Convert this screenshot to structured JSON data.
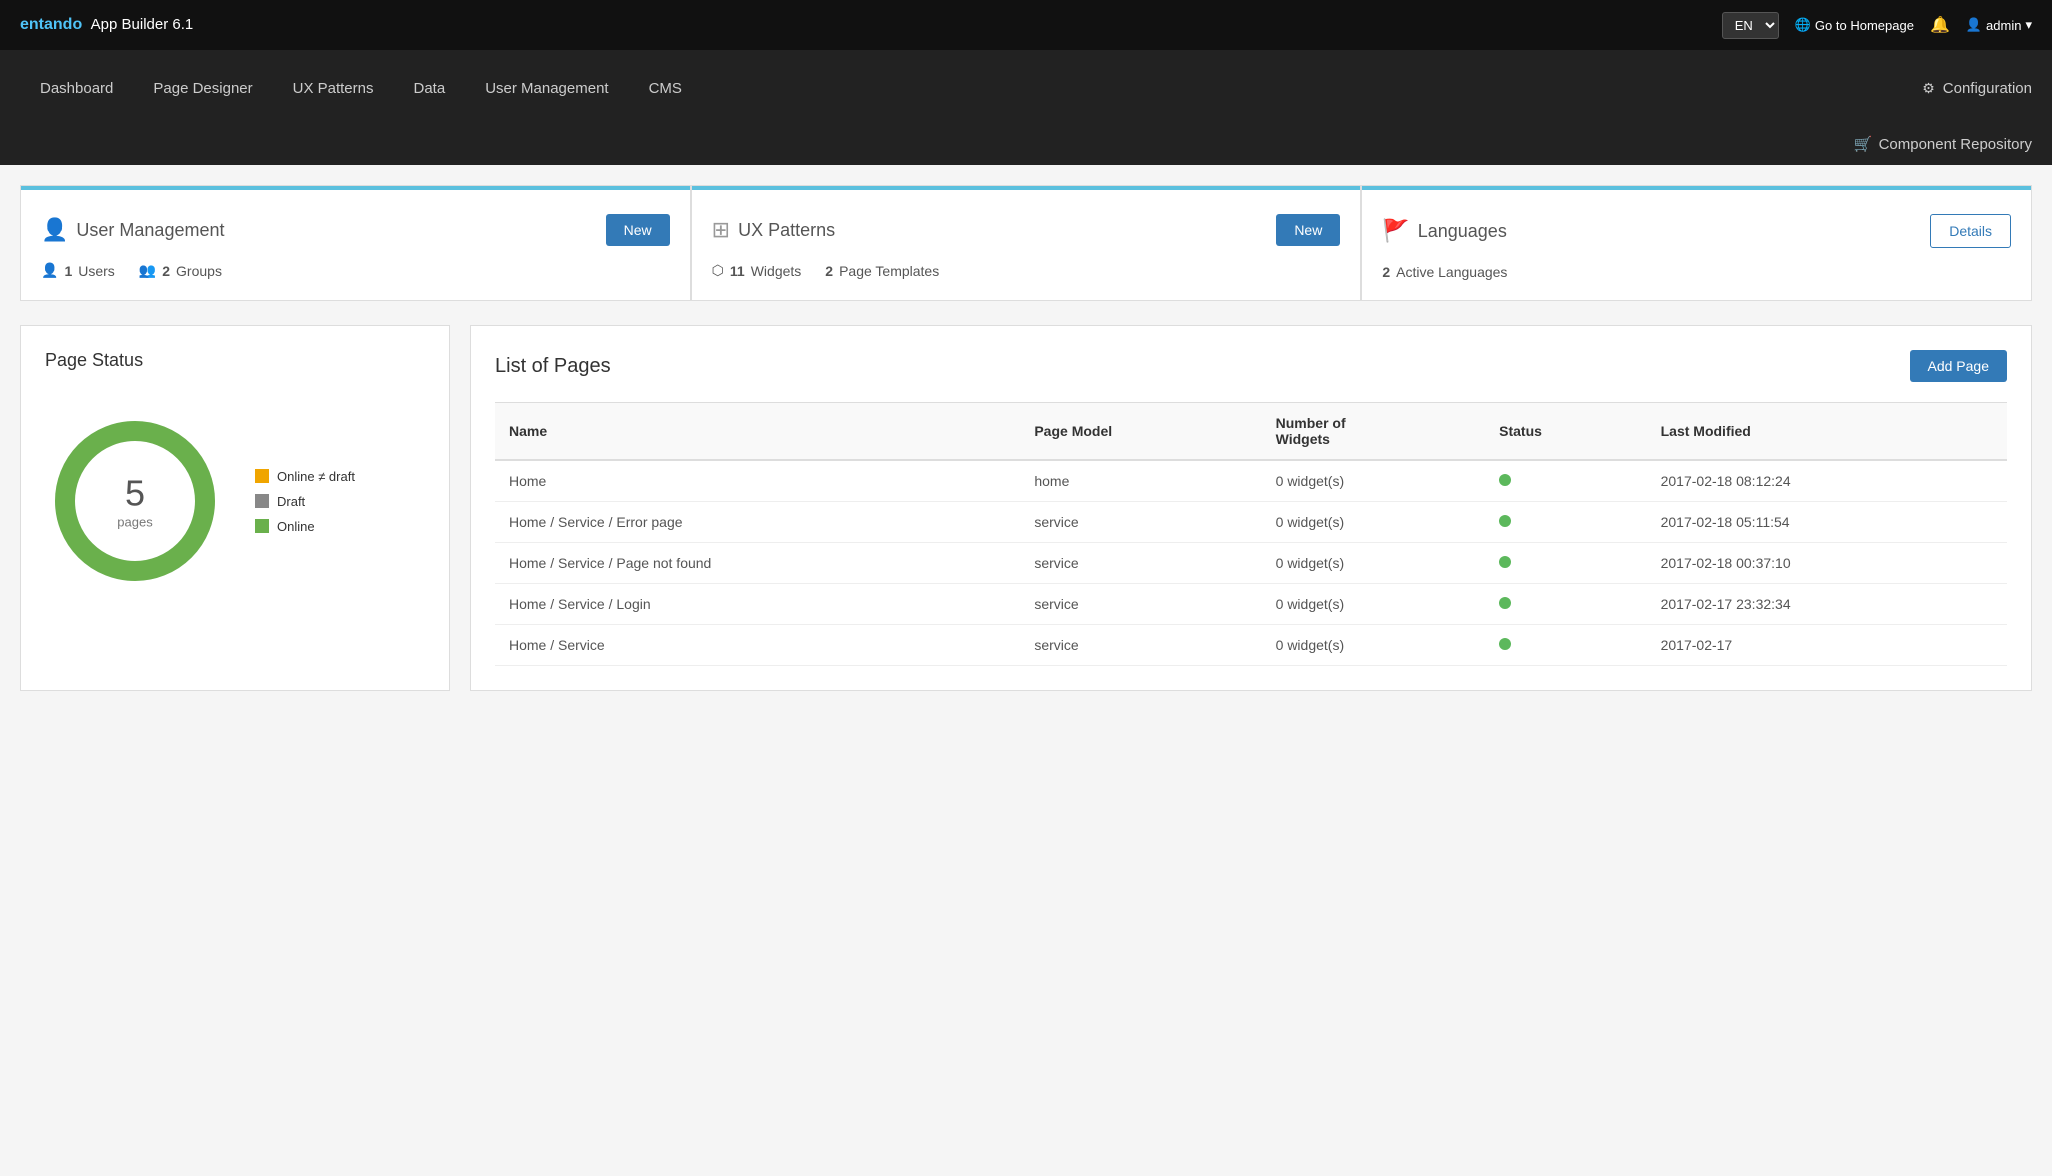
{
  "topbar": {
    "logo": "entando",
    "app_title": "App Builder 6.1",
    "lang": "EN",
    "goto_homepage": "Go to Homepage",
    "admin_label": "admin"
  },
  "navbar": {
    "items": [
      {
        "label": "Dashboard",
        "id": "dashboard"
      },
      {
        "label": "Page Designer",
        "id": "page-designer"
      },
      {
        "label": "UX Patterns",
        "id": "ux-patterns"
      },
      {
        "label": "Data",
        "id": "data"
      },
      {
        "label": "User Management",
        "id": "user-management"
      },
      {
        "label": "CMS",
        "id": "cms"
      }
    ],
    "configuration_label": "Configuration",
    "component_repository_label": "Component Repository"
  },
  "cards": {
    "user_management": {
      "title": "User Management",
      "btn_label": "New",
      "users_count": "1",
      "users_label": "Users",
      "groups_count": "2",
      "groups_label": "Groups"
    },
    "ux_patterns": {
      "title": "UX Patterns",
      "btn_label": "New",
      "widgets_count": "11",
      "widgets_label": "Widgets",
      "page_templates_count": "2",
      "page_templates_label": "Page Templates"
    },
    "languages": {
      "title": "Languages",
      "btn_label": "Details",
      "active_count": "2",
      "active_label": "Active Languages"
    }
  },
  "page_status": {
    "title": "Page Status",
    "total": "5",
    "total_label": "pages",
    "legend": [
      {
        "label": "Online ≠ draft",
        "color": "#f0a500"
      },
      {
        "label": "Draft",
        "color": "#888"
      },
      {
        "label": "Online",
        "color": "#6ab04c"
      }
    ]
  },
  "list_of_pages": {
    "title": "List of Pages",
    "add_btn": "Add Page",
    "columns": [
      "Name",
      "Page Model",
      "Number of Widgets",
      "Status",
      "Last Modified"
    ],
    "rows": [
      {
        "name": "Home",
        "model": "home",
        "widgets": "0 widget(s)",
        "status": "online",
        "modified": "2017-02-18 08:12:24"
      },
      {
        "name": "Home / Service / Error page",
        "model": "service",
        "widgets": "0 widget(s)",
        "status": "online",
        "modified": "2017-02-18 05:11:54"
      },
      {
        "name": "Home / Service / Page not found",
        "model": "service",
        "widgets": "0 widget(s)",
        "status": "online",
        "modified": "2017-02-18 00:37:10"
      },
      {
        "name": "Home / Service / Login",
        "model": "service",
        "widgets": "0 widget(s)",
        "status": "online",
        "modified": "2017-02-17 23:32:34"
      },
      {
        "name": "Home / Service",
        "model": "service",
        "widgets": "0 widget(s)",
        "status": "online",
        "modified": "2017-02-17"
      }
    ]
  }
}
